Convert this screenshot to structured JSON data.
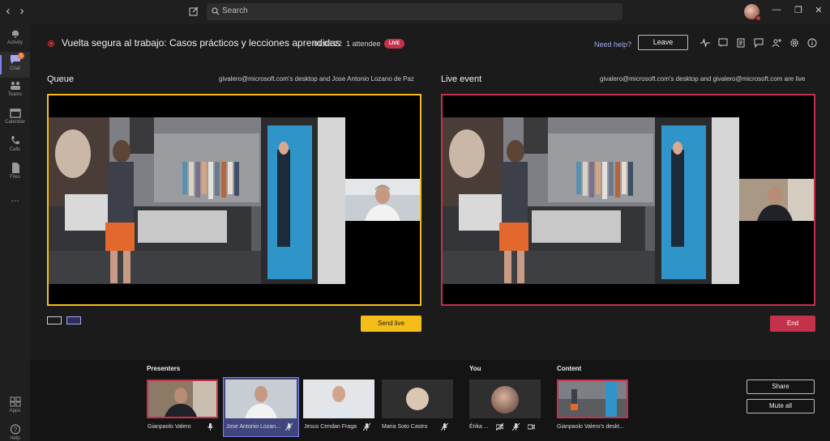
{
  "titlebar": {
    "search_placeholder": "Search",
    "back_glyph": "‹",
    "forward_glyph": "›"
  },
  "rail": {
    "items": [
      {
        "label": "Activity",
        "icon": "bell-icon"
      },
      {
        "label": "Chat",
        "icon": "chat-icon",
        "badge": "1"
      },
      {
        "label": "Teams",
        "icon": "teams-icon"
      },
      {
        "label": "Calendar",
        "icon": "calendar-icon"
      },
      {
        "label": "Calls",
        "icon": "phone-icon"
      },
      {
        "label": "Files",
        "icon": "file-icon"
      },
      {
        "label": "...",
        "icon": "more-icon"
      }
    ],
    "bottom": [
      {
        "label": "Apps",
        "icon": "apps-icon"
      },
      {
        "label": "Help",
        "icon": "help-icon"
      }
    ]
  },
  "event": {
    "title": "Vuelta segura al trabajo: Casos prácticos y lecciones aprendidas",
    "timer": "01:08:22",
    "attendees": "1 attendee",
    "live_badge": "LIVE",
    "help": "Need help?",
    "leave": "Leave"
  },
  "queue": {
    "title": "Queue",
    "subtitle": "givalero@microsoft.com's desktop and Jose Antonio Lozano de Paz",
    "send_label": "Send live"
  },
  "live": {
    "title": "Live event",
    "subtitle": "givalero@microsoft.com's desktop and givalero@microsoft.com are live",
    "end_label": "End"
  },
  "strip": {
    "presenters_label": "Presenters",
    "you_label": "You",
    "content_label": "Content",
    "presenters": [
      {
        "name": "Gianpaolo Valero"
      },
      {
        "name": "Jose Antonio Lozan..."
      },
      {
        "name": "Jesus Cendan Fraga"
      },
      {
        "name": "Maria Soto Castro"
      }
    ],
    "you": {
      "name": "Érika ..."
    },
    "content": {
      "name": "Gianpaolo Valero's deskt..."
    },
    "share_label": "Share",
    "mute_all_label": "Mute all"
  },
  "colors": {
    "queue_border": "#f5bd18",
    "live_border": "#c4314b",
    "accent": "#7b83eb"
  }
}
